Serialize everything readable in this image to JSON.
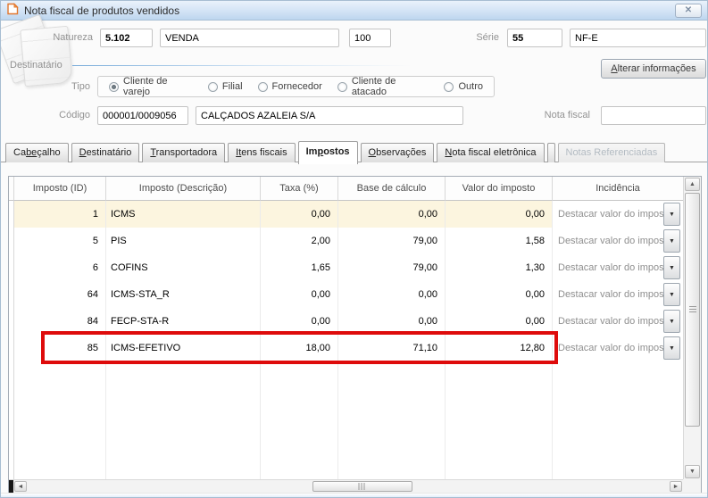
{
  "window": {
    "title": "Nota fiscal de produtos vendidos",
    "close_glyph": "✕"
  },
  "header": {
    "natureza_label": "Natureza",
    "natureza_code": "5.102",
    "natureza_name": "VENDA",
    "natureza_num": "100",
    "serie_label": "Série",
    "serie_code": "55",
    "serie_name": "NF-E"
  },
  "destinatario": {
    "group_label": "Destinatário",
    "tipo_label": "Tipo",
    "radios": [
      {
        "label": "Cliente de varejo",
        "selected": true
      },
      {
        "label": "Filial",
        "selected": false
      },
      {
        "label": "Fornecedor",
        "selected": false
      },
      {
        "label": "Cliente de atacado",
        "selected": false
      },
      {
        "label": "Outro",
        "selected": false
      }
    ],
    "alterar_button": {
      "pre": "",
      "key": "A",
      "post": "lterar informações"
    },
    "codigo_label": "Código",
    "codigo_value": "000001/0009056",
    "cliente_nome": "CALÇADOS AZALEIA S/A",
    "nota_fiscal_label": "Nota fiscal",
    "nota_fiscal_value": ""
  },
  "tabs": [
    {
      "pre": "Ca",
      "key": "be",
      "post": "çalho",
      "state": "normal"
    },
    {
      "pre": "",
      "key": "D",
      "post": "estinatário",
      "state": "normal"
    },
    {
      "pre": "",
      "key": "T",
      "post": "ransportadora",
      "state": "normal"
    },
    {
      "pre": "",
      "key": "It",
      "post": "ens fiscais",
      "state": "normal"
    },
    {
      "pre": "Im",
      "key": "p",
      "post": "ostos",
      "state": "active"
    },
    {
      "pre": "",
      "key": "O",
      "post": "bservações",
      "state": "normal"
    },
    {
      "pre": "",
      "key": "N",
      "post": "ota fiscal eletrônica",
      "state": "normal"
    },
    {
      "pre": "Notas Referenciadas",
      "key": "",
      "post": "",
      "state": "disabled"
    }
  ],
  "grid": {
    "columns": {
      "id": "Imposto (ID)",
      "descricao": "Imposto (Descrição)",
      "taxa": "Taxa (%)",
      "base": "Base de cálculo",
      "valor": "Valor do imposto",
      "incidencia": "Incidência"
    },
    "incidencia_value": "Destacar valor do imposto",
    "rows": [
      {
        "id": "1",
        "descricao": "ICMS",
        "taxa": "0,00",
        "base": "0,00",
        "valor": "0,00"
      },
      {
        "id": "5",
        "descricao": "PIS",
        "taxa": "2,00",
        "base": "79,00",
        "valor": "1,58"
      },
      {
        "id": "6",
        "descricao": "COFINS",
        "taxa": "1,65",
        "base": "79,00",
        "valor": "1,30"
      },
      {
        "id": "64",
        "descricao": "ICMS-STA_R",
        "taxa": "0,00",
        "base": "0,00",
        "valor": "0,00"
      },
      {
        "id": "84",
        "descricao": "FECP-STA-R",
        "taxa": "0,00",
        "base": "0,00",
        "valor": "0,00"
      },
      {
        "id": "85",
        "descricao": "ICMS-EFETIVO",
        "taxa": "18,00",
        "base": "71,10",
        "valor": "12,80"
      }
    ],
    "selected_row_index": 0,
    "annotation": {
      "highlighted_row_id": "85",
      "color": "#de0b0b"
    },
    "dropdown_glyph": "▼"
  },
  "scrollbar_glyphs": {
    "up": "▲",
    "down": "▼",
    "left": "◄",
    "right": "►"
  },
  "colors": {
    "titlebar_top": "#eaf2fb",
    "titlebar_bottom": "#bdd6ef",
    "selected_row": "#fcf5df",
    "accent_line": "#79acda",
    "annotation_red": "#de0b0b"
  }
}
